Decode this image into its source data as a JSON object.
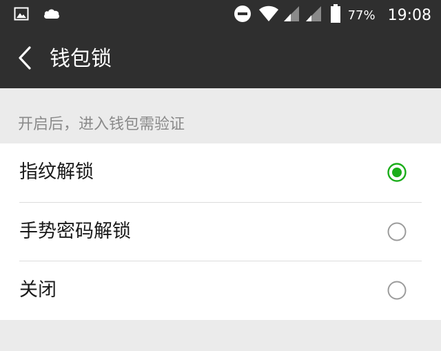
{
  "status_bar": {
    "icons_left": [
      "gallery-notification-icon",
      "cloud-notification-icon"
    ],
    "icons_right": [
      "do-not-disturb-icon",
      "wifi-icon",
      "cell-signal-icon",
      "cell-signal-icon",
      "battery-icon"
    ],
    "battery_percent": "77%",
    "time": "19:08"
  },
  "app_bar": {
    "back_icon": "chevron-left-icon",
    "title": "钱包锁"
  },
  "section": {
    "hint": "开启后，进入钱包需验证"
  },
  "options": [
    {
      "label": "指纹解锁",
      "selected": true
    },
    {
      "label": "手势密码解锁",
      "selected": false
    },
    {
      "label": "关闭",
      "selected": false
    }
  ],
  "colors": {
    "bar_background": "#2f2f2f",
    "page_background": "#ebebeb",
    "accent": "#1aad19",
    "radio_border": "#9b9b9b",
    "hint_text": "#8a8a8a"
  }
}
